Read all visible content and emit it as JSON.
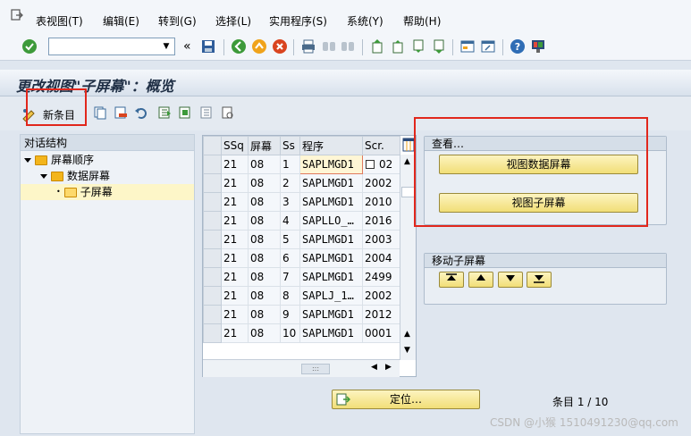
{
  "menu": {
    "items": [
      "表视图(T)",
      "编辑(E)",
      "转到(G)",
      "选择(L)",
      "实用程序(S)",
      "系统(Y)",
      "帮助(H)"
    ]
  },
  "toolbar": {
    "command_value": "",
    "collapse_symbol": "«"
  },
  "title": "更改视图\"子屏幕\"：概览",
  "app_toolbar": {
    "new_entry_label": "新条目"
  },
  "tree": {
    "header": "对话结构",
    "nodes": [
      "屏幕顺序",
      "数据屏幕",
      "子屏幕"
    ]
  },
  "table": {
    "columns": [
      "SSq",
      "屏幕",
      "Ss",
      "程序",
      "Scr."
    ],
    "rows": [
      [
        "21",
        "08",
        "1",
        "SAPLMGD1",
        "02"
      ],
      [
        "21",
        "08",
        "2",
        "SAPLMGD1",
        "2002"
      ],
      [
        "21",
        "08",
        "3",
        "SAPLMGD1",
        "2010"
      ],
      [
        "21",
        "08",
        "4",
        "SAPLLO_…",
        "2016"
      ],
      [
        "21",
        "08",
        "5",
        "SAPLMGD1",
        "2003"
      ],
      [
        "21",
        "08",
        "6",
        "SAPLMGD1",
        "2004"
      ],
      [
        "21",
        "08",
        "7",
        "SAPLMGD1",
        "2499"
      ],
      [
        "21",
        "08",
        "8",
        "SAPLJ_1…",
        "2002"
      ],
      [
        "21",
        "08",
        "9",
        "SAPLMGD1",
        "2012"
      ],
      [
        "21",
        "08",
        "10",
        "SAPLMGD1",
        "0001"
      ]
    ]
  },
  "view_group": {
    "title": "查看…",
    "btn_data_screen": "视图数据屏幕",
    "btn_subscreen": "视图子屏幕"
  },
  "move_group": {
    "title": "移动子屏幕"
  },
  "locate_button": "定位…",
  "entry_count": "条目 1 / 10",
  "watermark": "CSDN @小猴 1510491230@qq.com",
  "colors": {
    "highlight_border": "#e1271c",
    "button_yellow": "#f1de77"
  }
}
